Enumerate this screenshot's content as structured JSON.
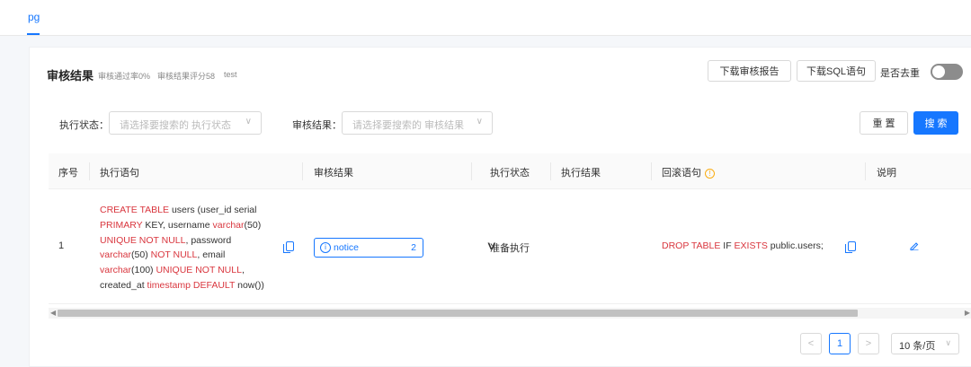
{
  "tabs": [
    {
      "label": "pg"
    }
  ],
  "card": {
    "title": "审核结果",
    "pass_rate": "审核通过率0%",
    "score": "审核结果评分58",
    "db": "test"
  },
  "actions": {
    "download_report": "下载审核报告",
    "download_sql": "下载SQL语句",
    "dedupe_label": "是否去重",
    "dedupe_on": false
  },
  "filters": {
    "exec_status_label": "执行状态：",
    "exec_status_placeholder": "请选择要搜索的 执行状态",
    "audit_result_label": "审核结果：",
    "audit_result_placeholder": "请选择要搜索的 审核结果",
    "reset": "重 置",
    "search": "搜 索"
  },
  "table": {
    "columns": [
      "序号",
      "执行语句",
      "审核结果",
      "执行状态",
      "执行结果",
      "回滚语句",
      "说明"
    ],
    "rows": [
      {
        "index": "1",
        "sql_lines": [
          [
            {
              "t": "CREATE TABLE",
              "k": true
            },
            {
              "t": " users (user_id serial",
              "k": false
            }
          ],
          [
            {
              "t": "PRIMARY",
              "k": true
            },
            {
              "t": " KEY, username ",
              "k": false
            },
            {
              "t": "varchar",
              "k": true
            },
            {
              "t": "(50)",
              "k": false
            }
          ],
          [
            {
              "t": "UNIQUE NOT NULL",
              "k": true
            },
            {
              "t": ", password",
              "k": false
            }
          ],
          [
            {
              "t": "varchar",
              "k": true
            },
            {
              "t": "(50) ",
              "k": false
            },
            {
              "t": "NOT NULL",
              "k": true
            },
            {
              "t": ", email",
              "k": false
            }
          ],
          [
            {
              "t": "varchar",
              "k": true
            },
            {
              "t": "(100) ",
              "k": false
            },
            {
              "t": "UNIQUE NOT NULL",
              "k": true
            },
            {
              "t": ",",
              "k": false
            }
          ],
          [
            {
              "t": "created_at ",
              "k": false
            },
            {
              "t": "timestamp DEFAULT",
              "k": true
            },
            {
              "t": " now())",
              "k": false
            }
          ]
        ],
        "audit_level": "notice",
        "audit_count": "2",
        "exec_status": "准备执行",
        "exec_result": "",
        "rollback": [
          {
            "t": "DROP TABLE",
            "k": true
          },
          {
            "t": " IF ",
            "k": false
          },
          {
            "t": "EXISTS",
            "k": true
          },
          {
            "t": " public.users;",
            "k": false
          }
        ]
      }
    ]
  },
  "pagination": {
    "prev": "<",
    "current": "1",
    "next": ">",
    "page_size": "10 条/页"
  },
  "icons": {
    "copy": "copy-icon",
    "edit": "edit-icon",
    "warn": "info-circle-icon",
    "expand": "chevron-down-icon"
  },
  "colors": {
    "primary": "#1677ff",
    "keyword": "#d9363e",
    "warning": "#faad14"
  }
}
